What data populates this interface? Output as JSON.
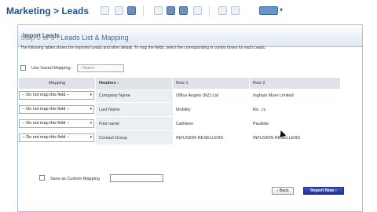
{
  "app": {
    "title": "Marketing > Leads"
  },
  "toolbar": {
    "icons": [
      "new-icon",
      "delete-icon",
      "edit-icon",
      "print-icon",
      "calendar-icon",
      "save-icon",
      "prev-icon",
      "next-icon",
      "view-menu-icon"
    ],
    "accent": "#1f4f8f"
  },
  "panel": {
    "title": "Import Leads"
  },
  "step": {
    "prefix": "Step 2 of 3 :",
    "title": "Leads List & Mapping"
  },
  "description": "The following tables shows the imported Leads and other details. To map the fields, select the corresponding in combo boxes for each Leads.",
  "saved_mapping": {
    "label": "Use Saved Mapping :",
    "placeholder": "--Select--"
  },
  "table": {
    "headers": [
      "Mapping",
      "Headers :",
      "Row 1",
      "Row 2"
    ],
    "rows": [
      {
        "mapping": "-- Do not map this field --",
        "header": "Company Name",
        "row1": "Office Angels (NZ) Ltd",
        "row2": "Ingham More Limited"
      },
      {
        "mapping": "-- Do not map this field --",
        "header": "Last Name",
        "row1": "Mobility",
        "row2": "Ro...rs"
      },
      {
        "mapping": "-- Do not map this field --",
        "header": "First name",
        "row1": "Cathleen",
        "row2": "Paulette"
      },
      {
        "mapping": "-- Do not map this field --",
        "header": "Contact Group",
        "row1": "INFUSION RESELLERS",
        "row2": "INFUSION RESELLERS"
      }
    ]
  },
  "custom_mapping": {
    "label": "Save as Custom Mapping"
  },
  "buttons": {
    "back": "‹ Back",
    "import": "Import Now ›"
  }
}
